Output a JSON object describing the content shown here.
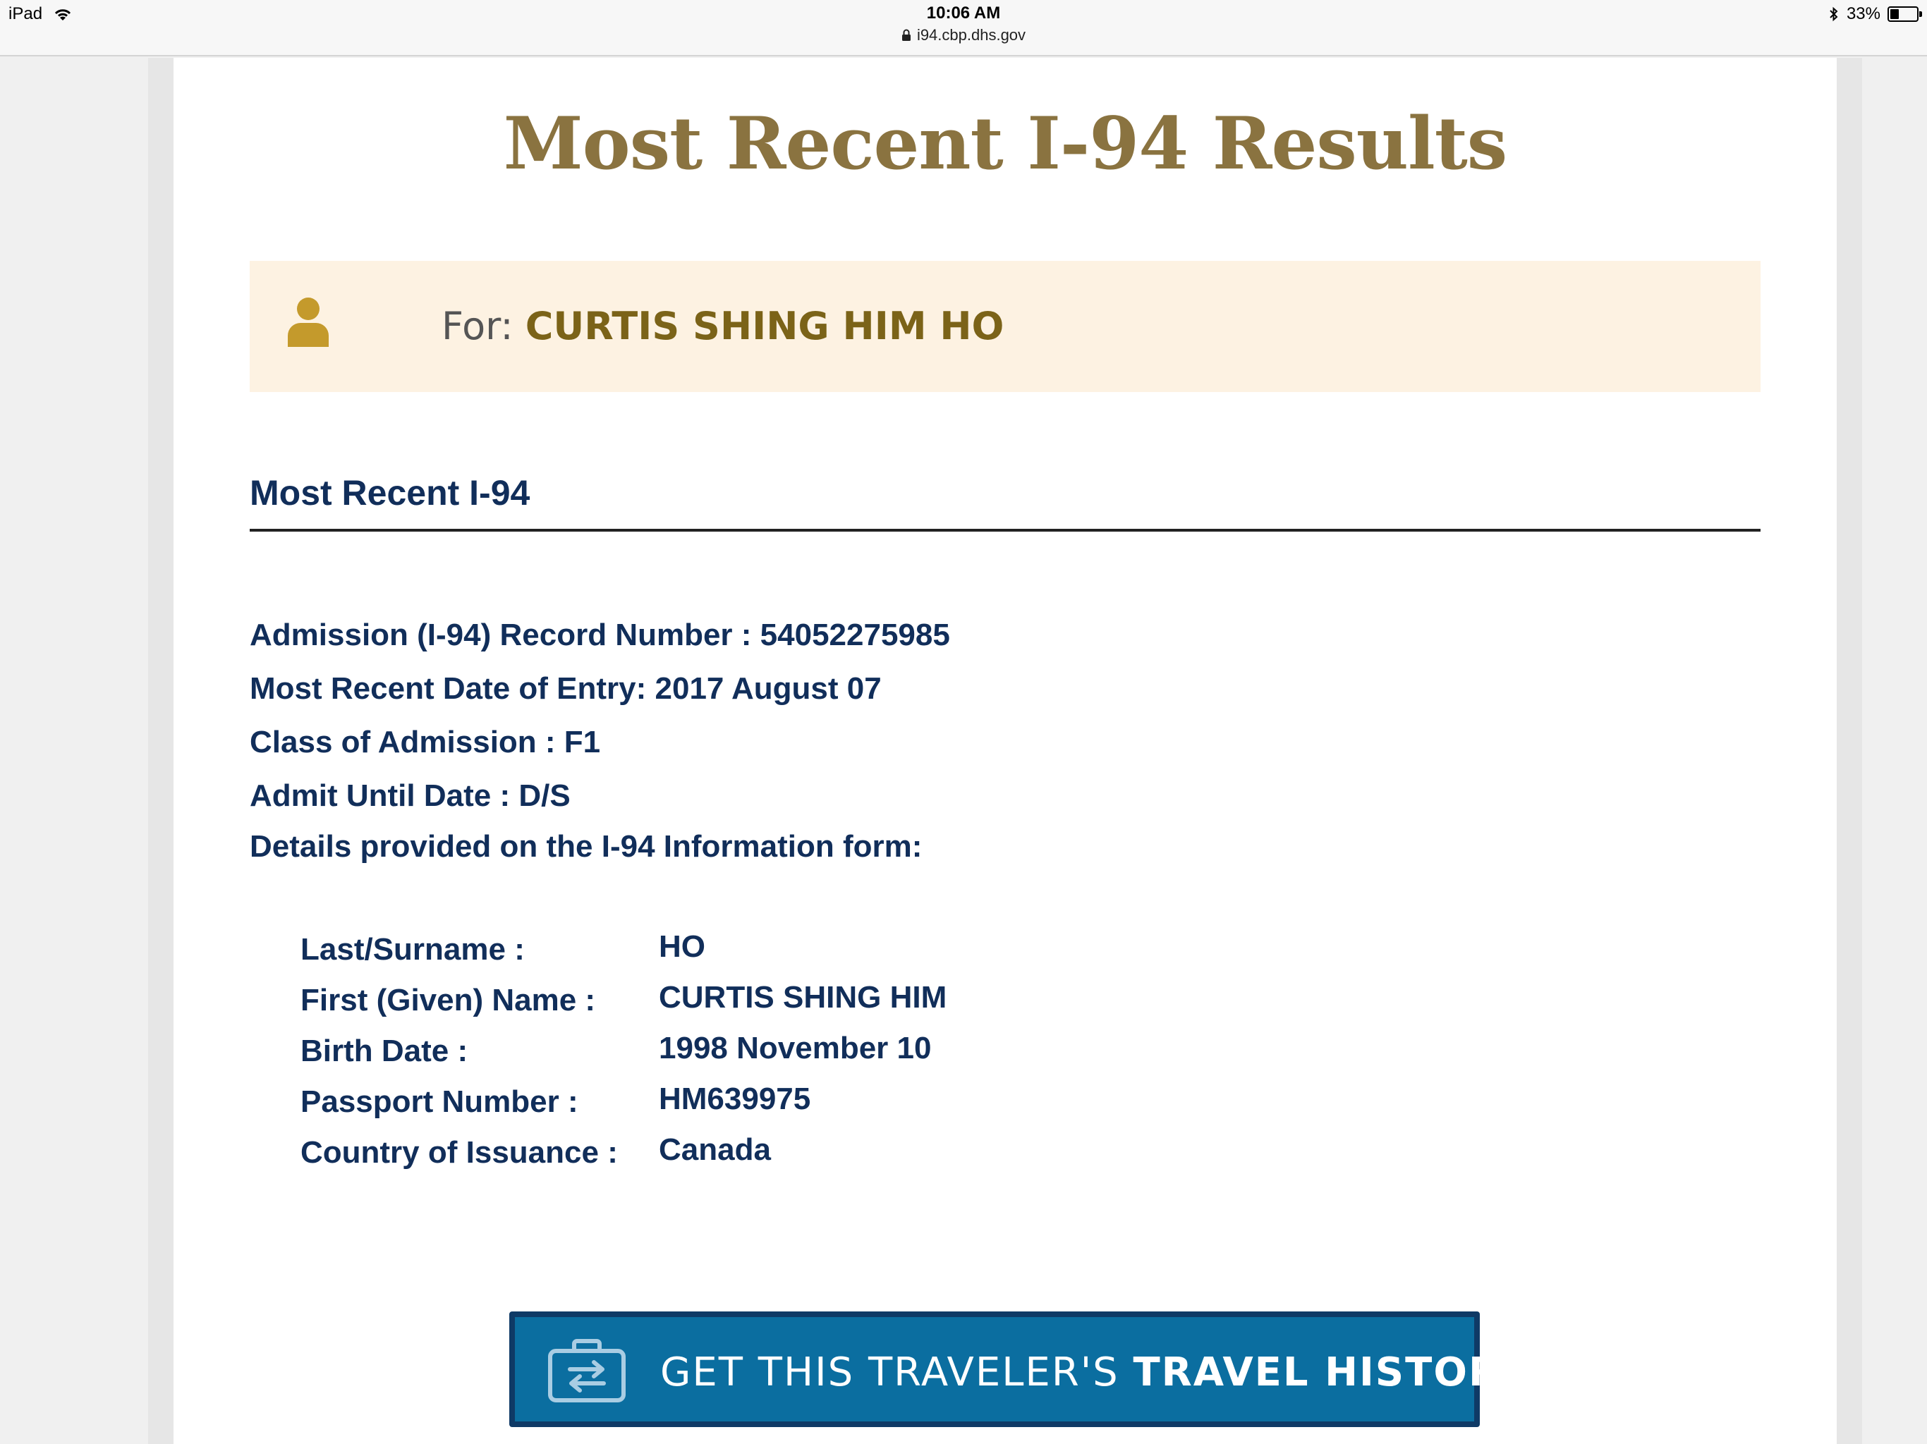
{
  "status_bar": {
    "device": "iPad",
    "time": "10:06 AM",
    "url": "i94.cbp.dhs.gov",
    "battery": "33%",
    "battery_level": 0.33
  },
  "page": {
    "title": "Most Recent I-94 Results",
    "for_label": "For:",
    "for_name": "CURTIS SHING HIM HO",
    "section_title": "Most Recent I-94"
  },
  "record": {
    "admission_number": "Admission (I-94) Record Number : 54052275985",
    "date_of_entry": "Most Recent Date of Entry: 2017 August 07",
    "class_of_admission": "Class of Admission : F1",
    "admit_until": "Admit Until Date : D/S",
    "details_heading": "Details provided on the I-94 Information form:"
  },
  "details": [
    {
      "label": "Last/Surname :",
      "value": "HO"
    },
    {
      "label": "First (Given) Name :",
      "value": "CURTIS SHING HIM"
    },
    {
      "label": "Birth Date :",
      "value": "1998 November 10"
    },
    {
      "label": "Passport Number :",
      "value": "HM639975"
    },
    {
      "label": "Country of Issuance :",
      "value": "Canada"
    }
  ],
  "travel_button": {
    "prefix": "GET THIS TRAVELER'S ",
    "emphasis": "TRAVEL HISTORY"
  },
  "colors": {
    "title_gold": "#8a7340",
    "navy": "#112e5a",
    "banner_bg": "#fdf2e2",
    "icon_gold": "#c49a2c",
    "button_blue": "#0b6ea0"
  }
}
